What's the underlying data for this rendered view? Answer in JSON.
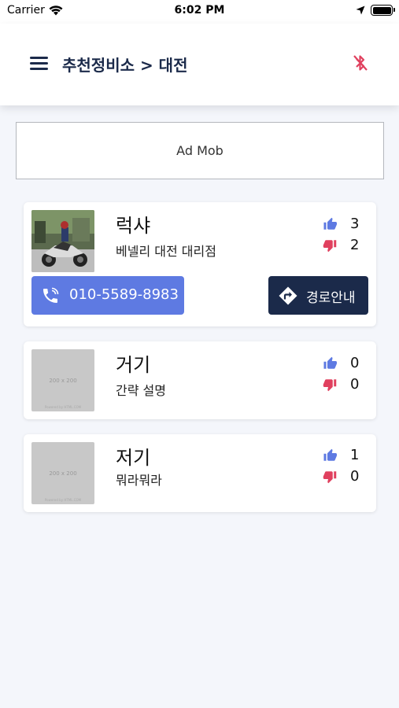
{
  "status_bar": {
    "carrier": "Carrier",
    "time": "6:02 PM",
    "icons": [
      "wifi-icon",
      "location-arrow-icon",
      "battery-icon"
    ]
  },
  "header": {
    "title": "추천정비소 > 대전",
    "menu_icon": "hamburger-menu-icon",
    "bluetooth_icon": "bluetooth-disabled-icon"
  },
  "ad": {
    "label": "Ad Mob"
  },
  "shops": [
    {
      "name": "럭샤",
      "description": "베넬리 대전 대리점",
      "likes": "3",
      "dislikes": "2",
      "phone": "010-5589-8983",
      "directions_label": "경로안내",
      "thumbnail": "motorcycle-photo"
    },
    {
      "name": "거기",
      "description": "간략 설명",
      "likes": "0",
      "dislikes": "0",
      "thumbnail_label": "200 x 200",
      "thumbnail_credit": "Powered by HTML.COM"
    },
    {
      "name": "저기",
      "description": "뭐라뭐라",
      "likes": "1",
      "dislikes": "0",
      "thumbnail_label": "200 x 200",
      "thumbnail_credit": "Powered by HTML.COM"
    }
  ],
  "colors": {
    "primary_navy": "#1b2a4a",
    "call_blue": "#5e7ae2",
    "like_blue": "#5e7ae2",
    "dislike_red": "#e0405e",
    "bluetooth_red": "#e0405e",
    "background": "#f4f6fb"
  }
}
